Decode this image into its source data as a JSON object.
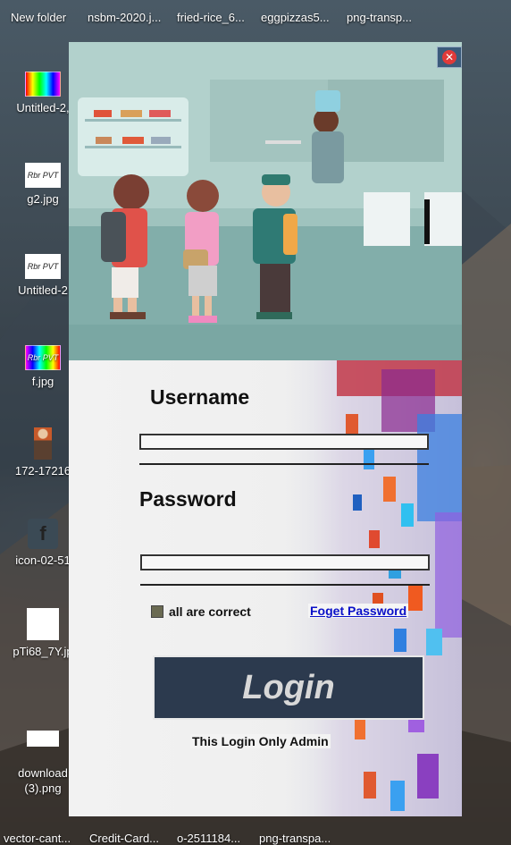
{
  "desktop": {
    "top_files": [
      "New folder",
      "nsbm-2020.j...",
      "fried-rice_6...",
      "eggpizzas5...",
      "png-transp..."
    ],
    "left_icons": [
      {
        "label": "Untitled-2,",
        "icon": "gradient-image-icon"
      },
      {
        "label": "g2.jpg",
        "icon": "rbr-pvt-image-icon",
        "thumb_text": "Rbr PVT"
      },
      {
        "label": "Untitled-2",
        "icon": "rbr-pvt-image-icon",
        "thumb_text": "Rbr PVT"
      },
      {
        "label": "f.jpg",
        "icon": "gradient-image-icon",
        "thumb_text": "Rbr PVT"
      },
      {
        "label": "172-17216",
        "icon": "person-image-icon"
      },
      {
        "label": "icon-02-51",
        "icon": "facebook-icon"
      },
      {
        "label": "pTi68_7Y.jp",
        "icon": "logo-image-icon"
      },
      {
        "label": "download\n(3).png",
        "icon": "logo-image-icon"
      }
    ],
    "bottom_files": [
      "vector-cant...",
      "Credit-Card...",
      "o-2511184...",
      "png-transpa..."
    ]
  },
  "window": {
    "close_icon": "close-icon",
    "username_label": "Username",
    "username_value": "",
    "password_label": "Password",
    "password_value": "",
    "checkbox_label": "all are correct",
    "checkbox_checked": false,
    "forgot_link": "Foget Password",
    "login_button": "Login",
    "note": "This Login Only Admin",
    "colors": {
      "button_bg": "#2c3a4e",
      "link": "#0a10c8",
      "hero_bg": "#b2d1cc"
    }
  }
}
